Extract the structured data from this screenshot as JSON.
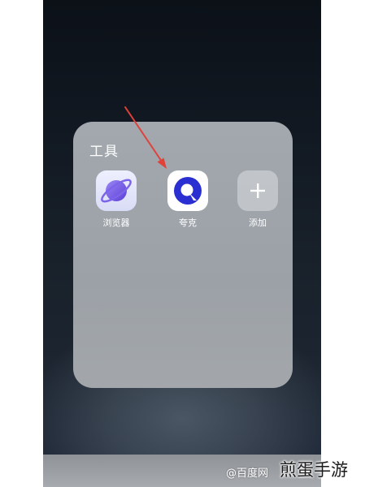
{
  "folder": {
    "title": "工具",
    "apps": [
      {
        "label": "浏览器",
        "icon": "planet-icon"
      },
      {
        "label": "夸克",
        "icon": "quark-logo-icon"
      },
      {
        "label": "添加",
        "icon": "plus-icon"
      }
    ]
  },
  "watermarks": {
    "source": "@百度网",
    "brand": "煎蛋手游"
  },
  "colors": {
    "arrow": "#e0413a",
    "browser_planet": "#7a62e8",
    "quark_blue": "#2a2fd1"
  }
}
